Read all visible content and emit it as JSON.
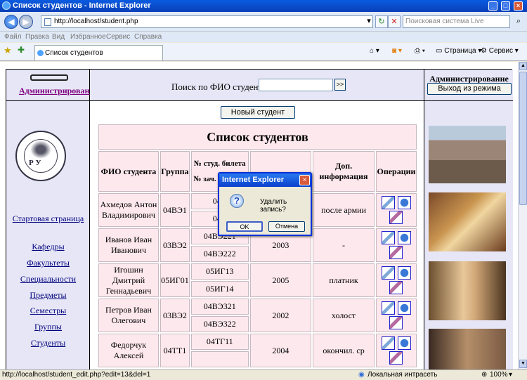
{
  "window": {
    "title": "Список студентов - Internet Explorer"
  },
  "address": {
    "url": "http://localhost/student.php",
    "search_placeholder": "Поисковая система Live"
  },
  "menu": [
    "Файл",
    "Правка",
    "Вид",
    "Избранное",
    "Сервис",
    "Справка"
  ],
  "tab": {
    "title": "Список студентов"
  },
  "tools": {
    "page": "Страница",
    "service": "Сервис"
  },
  "header": {
    "admin_link": "Администрирование",
    "search_label": "Поиск по ФИО студента",
    "search_go": ">>",
    "admin_title": "Администрирование",
    "exit_button": "Выход из режима"
  },
  "sidebar": {
    "seal_text": "Р У",
    "links": [
      "Стартовая страница",
      "Кафедры",
      "Факультеты",
      "Специальности",
      "Предметы",
      "Семестры",
      "Группы",
      "Студенты"
    ]
  },
  "main": {
    "new_button": "Новый студент",
    "table_title": "Список студентов",
    "headers": {
      "fio": "ФИО студента",
      "group": "Группа",
      "ticket": "№ студ. билета",
      "book": "№ зач. книжки",
      "info": "Доп. информация",
      "ops": "Операции"
    },
    "rows": [
      {
        "fio": "Ахмедов Антон Владимирович",
        "group": "04ВЭ1",
        "ticket": "04В",
        "book": "04В",
        "year": "",
        "info": "после армии"
      },
      {
        "fio": "Иванов Иван Иванович",
        "group": "03ВЭ2",
        "ticket": "04ВЭ221",
        "book": "04ВЭ222",
        "year": "2003",
        "info": "-"
      },
      {
        "fio": "Игошин Дмитрий Геннадьевич",
        "group": "05ИГ01",
        "ticket": "05ИГ13",
        "book": "05ИГ14",
        "year": "2005",
        "info": "платник"
      },
      {
        "fio": "Петров Иван Олегович",
        "group": "03ВЭ2",
        "ticket": "04ВЭ321",
        "book": "04ВЭ322",
        "year": "2002",
        "info": "холост"
      },
      {
        "fio": "Федорчук Алексей",
        "group": "04ТТ1",
        "ticket": "04ТГ11",
        "book": "",
        "year": "2004",
        "info": "окончил. ср"
      }
    ]
  },
  "dialog": {
    "title": "Internet Explorer",
    "message": "Удалить запись?",
    "ok": "OK",
    "cancel": "Отмена"
  },
  "status": {
    "url": "http://localhost/student_edit.php?edit=13&del=1",
    "zone": "Локальная интрасеть",
    "zoom": "100%"
  }
}
